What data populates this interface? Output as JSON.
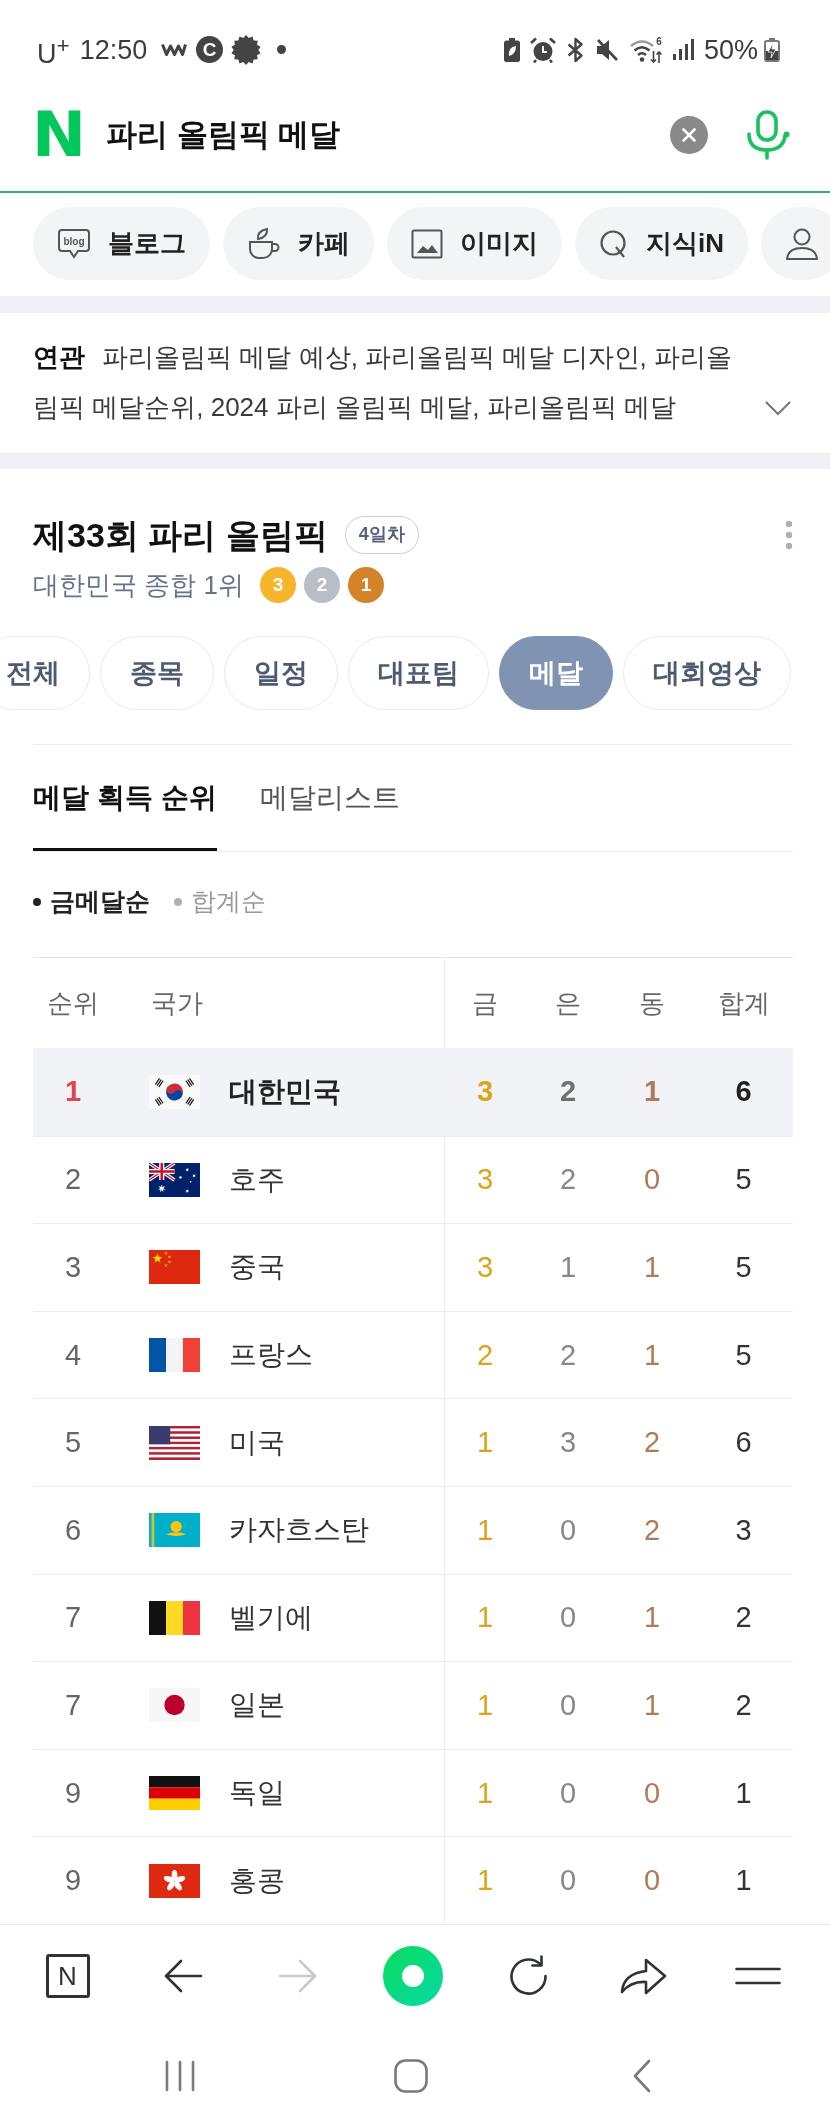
{
  "status_bar": {
    "carrier": "U$^{+}$",
    "time": "12:50",
    "app_badge": "C",
    "wifi_badge": "6",
    "battery": "50%"
  },
  "search": {
    "logo": "N",
    "value": "파리 올림픽 메달"
  },
  "chips": [
    {
      "kind": "blog",
      "icon_text": "blog",
      "label": "블로그"
    },
    {
      "kind": "cafe",
      "label": "카페"
    },
    {
      "kind": "image",
      "label": "이미지"
    },
    {
      "kind": "kin",
      "label": "지식iN"
    },
    {
      "kind": "person"
    }
  ],
  "related": {
    "text": "**연관** 파리올림픽 메달 예상, 파리올림픽 메달 디자인, 파리올림픽 메달순위, 2024 파리 올림픽 메달, 파리올림픽 메달"
  },
  "olympics": {
    "title": "제33회 파리 올림픽",
    "day_badge": "4일차",
    "summary": "대한민국 종합 1위",
    "medals": [
      {
        "count": "3",
        "color": "#f7b52b"
      },
      {
        "count": "2",
        "color": "#b9bec6"
      },
      {
        "count": "1",
        "color": "#d4832a"
      }
    ]
  },
  "tabs": [
    {
      "label": "전체",
      "selected": false
    },
    {
      "label": "종목",
      "selected": false
    },
    {
      "label": "일정",
      "selected": false
    },
    {
      "label": "대표팀",
      "selected": false
    },
    {
      "label": "메달",
      "selected": true
    },
    {
      "label": "대회영상",
      "selected": false
    }
  ],
  "subtabs": [
    {
      "label": "메달 획득 순위",
      "selected": true
    },
    {
      "label": "메달리스트",
      "selected": false
    }
  ],
  "sort_options": [
    {
      "label": "금메달순",
      "selected": true
    },
    {
      "label": "합계순",
      "selected": false
    }
  ],
  "table": {
    "columns": [
      "순위",
      "국가",
      "금",
      "은",
      "동",
      "합계"
    ],
    "rows": [
      {
        "rank": "1",
        "kind": "kr",
        "country": "대한민국",
        "gold": "3",
        "silver": "2",
        "bronze": "1",
        "total": "6",
        "highlighted": true
      },
      {
        "rank": "2",
        "kind": "au",
        "country": "호주",
        "gold": "3",
        "silver": "2",
        "bronze": "0",
        "total": "5",
        "highlighted": false
      },
      {
        "rank": "3",
        "kind": "cn",
        "country": "중국",
        "gold": "3",
        "silver": "1",
        "bronze": "1",
        "total": "5",
        "highlighted": false
      },
      {
        "rank": "4",
        "kind": "fr",
        "country": "프랑스",
        "gold": "2",
        "silver": "2",
        "bronze": "1",
        "total": "5",
        "highlighted": false
      },
      {
        "rank": "5",
        "kind": "us",
        "country": "미국",
        "gold": "1",
        "silver": "3",
        "bronze": "2",
        "total": "6",
        "highlighted": false
      },
      {
        "rank": "6",
        "kind": "kz",
        "country": "카자흐스탄",
        "gold": "1",
        "silver": "0",
        "bronze": "2",
        "total": "3",
        "highlighted": false
      },
      {
        "rank": "7",
        "kind": "be",
        "country": "벨기에",
        "gold": "1",
        "silver": "0",
        "bronze": "1",
        "total": "2",
        "highlighted": false
      },
      {
        "rank": "7",
        "kind": "jp",
        "country": "일본",
        "gold": "1",
        "silver": "0",
        "bronze": "1",
        "total": "2",
        "highlighted": false
      },
      {
        "rank": "9",
        "kind": "de",
        "country": "독일",
        "gold": "1",
        "silver": "0",
        "bronze": "0",
        "total": "1",
        "highlighted": false
      },
      {
        "rank": "9",
        "kind": "hk",
        "country": "홍콩",
        "gold": "1",
        "silver": "0",
        "bronze": "0",
        "total": "1",
        "highlighted": false
      }
    ]
  },
  "toolbar": [
    {
      "kind": "naver",
      "icon_text": "N",
      "disabled": false
    },
    {
      "kind": "back",
      "disabled": false
    },
    {
      "kind": "forward",
      "disabled": true
    },
    {
      "kind": "home",
      "disabled": false
    },
    {
      "kind": "refresh",
      "disabled": false
    },
    {
      "kind": "share",
      "disabled": false
    },
    {
      "kind": "menu",
      "disabled": false
    }
  ]
}
